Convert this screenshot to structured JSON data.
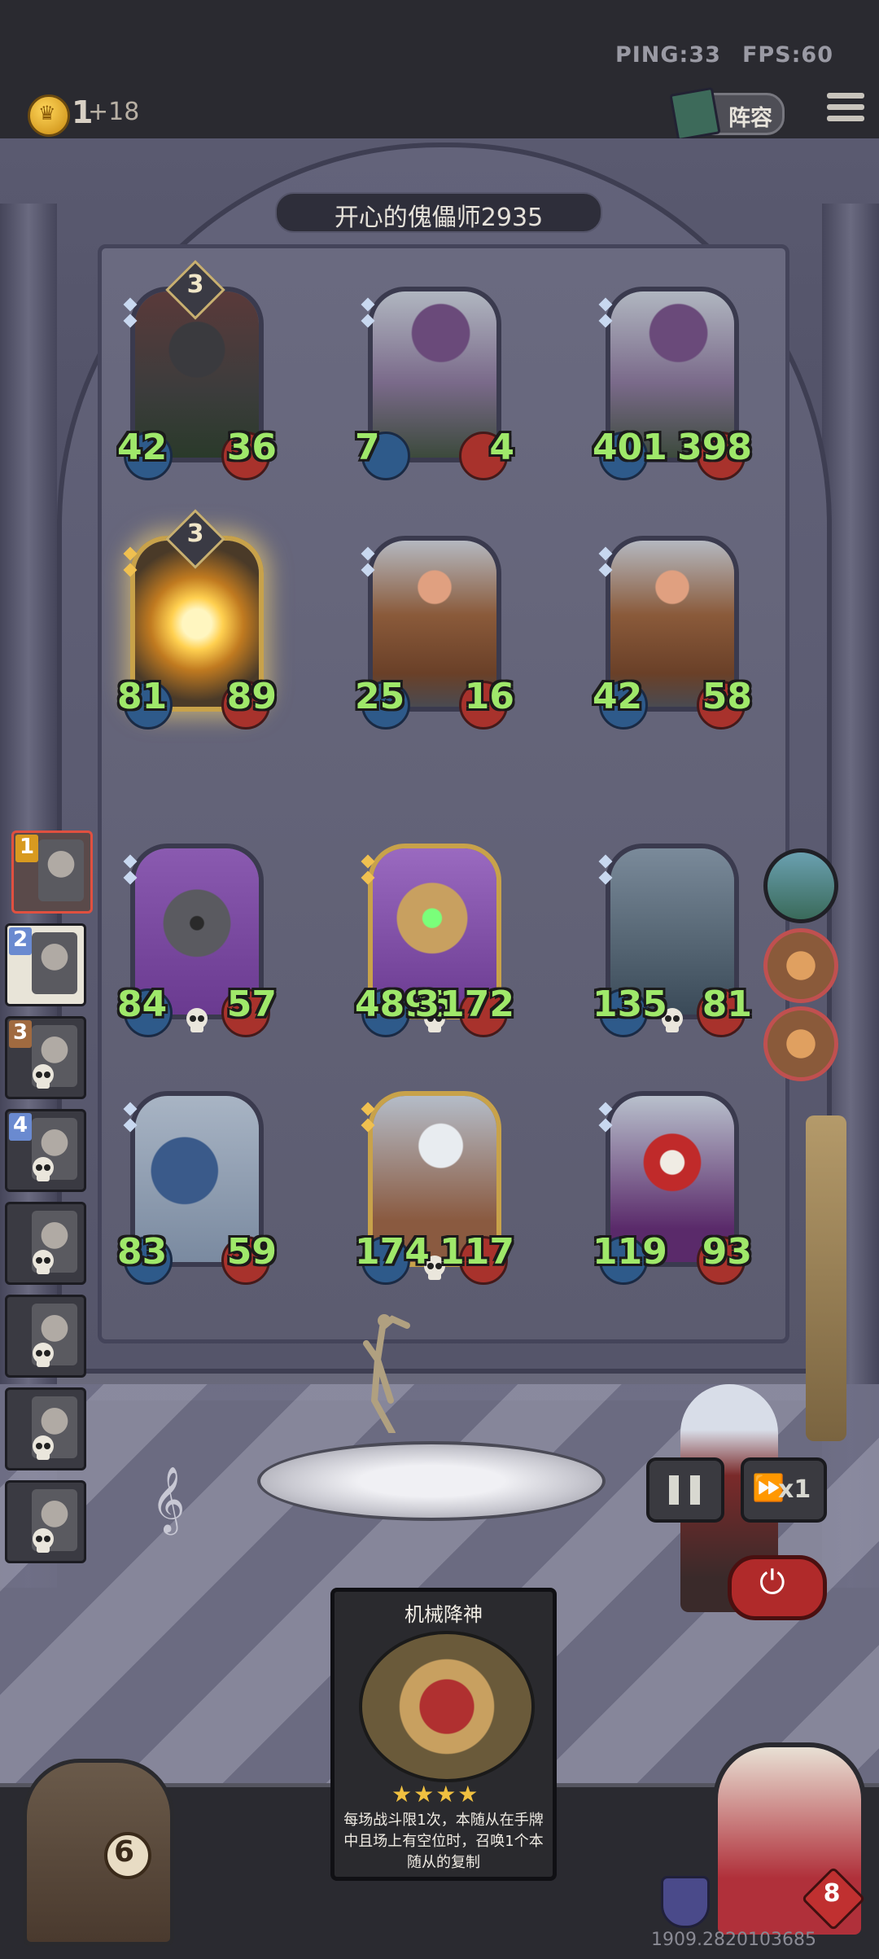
{
  "network": {
    "ping": "PING:33",
    "fps": "FPS:60"
  },
  "player": {
    "gold": "1",
    "gold_income": "+18"
  },
  "top": {
    "lineup_label": "阵容"
  },
  "opponent": {
    "name": "开心的傀儡师2935"
  },
  "board": {
    "rows": [
      [
        {
          "name": "shield-knight-minion",
          "atk": "42",
          "hp": "36",
          "tier": "3",
          "gold": false,
          "glow": false,
          "art": "knight"
        },
        {
          "name": "hunter-minion",
          "atk": "7",
          "hp": "4",
          "tier": "",
          "gold": false,
          "glow": false,
          "art": "hunter"
        },
        {
          "name": "hunter-minion-2",
          "atk": "401",
          "hp": "398",
          "tier": "",
          "gold": false,
          "glow": false,
          "art": "hunter"
        }
      ],
      [
        {
          "name": "fire-golem-minion",
          "atk": "81",
          "hp": "89",
          "tier": "3",
          "gold": true,
          "glow": true,
          "art": "fire"
        },
        {
          "name": "guard-minion",
          "atk": "25",
          "hp": "16",
          "tier": "",
          "gold": false,
          "glow": false,
          "art": "guard"
        },
        {
          "name": "guard-minion-2",
          "atk": "42",
          "hp": "58",
          "tier": "",
          "gold": false,
          "glow": false,
          "art": "guard"
        }
      ],
      [
        {
          "name": "robot-minion",
          "atk": "84",
          "hp": "57",
          "tier": "",
          "gold": false,
          "glow": false,
          "art": "robot",
          "skull": true
        },
        {
          "name": "mech-laser-minion",
          "atk": "4895",
          "hp": "3172",
          "tier": "",
          "gold": true,
          "glow": false,
          "art": "mech",
          "skull": true
        },
        {
          "name": "chest-minion",
          "atk": "135",
          "hp": "81",
          "tier": "",
          "gold": false,
          "glow": false,
          "art": "chest",
          "skull": true
        }
      ],
      [
        {
          "name": "dragon-minion",
          "atk": "83",
          "hp": "59",
          "tier": "",
          "gold": false,
          "glow": false,
          "art": "dragon"
        },
        {
          "name": "bot-minion",
          "atk": "174",
          "hp": "117",
          "tier": "",
          "gold": true,
          "glow": false,
          "art": "bot",
          "skull": true
        },
        {
          "name": "clown-minion",
          "atk": "119",
          "hp": "93",
          "tier": "",
          "gold": false,
          "glow": false,
          "art": "clown"
        }
      ]
    ]
  },
  "roster": [
    {
      "num": "1",
      "tag": "gold"
    },
    {
      "num": "2",
      "tag": "blue"
    },
    {
      "num": "3",
      "tag": "brown",
      "dead": true
    },
    {
      "num": "4",
      "tag": "blue",
      "dead": true
    },
    {
      "num": "",
      "tag": "",
      "dead": true
    },
    {
      "num": "",
      "tag": "",
      "dead": true
    },
    {
      "num": "",
      "tag": "",
      "dead": true
    },
    {
      "num": "",
      "tag": "",
      "dead": true
    }
  ],
  "controls": {
    "speed_label": "x1"
  },
  "spell_card": {
    "title": "机械降神",
    "stars": "★★★★",
    "description": "每场战斗限1次，本随从在手牌中且场上有空位时，召唤1个本随从的复制"
  },
  "shop": {
    "count": "6"
  },
  "hero": {
    "health": "8"
  },
  "footer": {
    "version": "1909.2820103685"
  }
}
